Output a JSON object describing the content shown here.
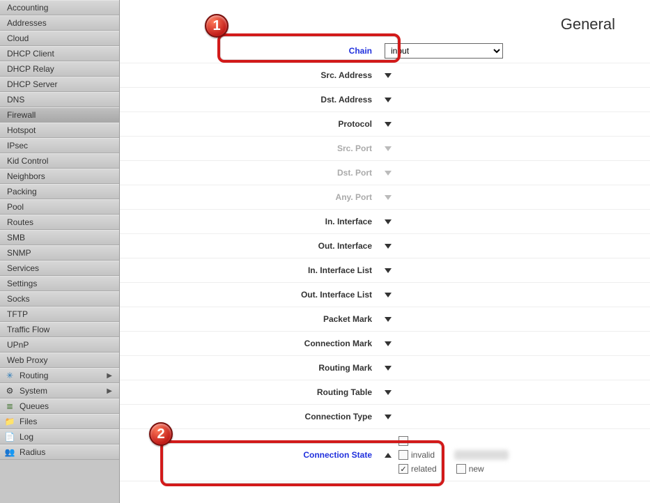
{
  "title": "General",
  "sidebar": {
    "items": [
      {
        "label": "Accounting"
      },
      {
        "label": "Addresses"
      },
      {
        "label": "Cloud"
      },
      {
        "label": "DHCP Client"
      },
      {
        "label": "DHCP Relay"
      },
      {
        "label": "DHCP Server"
      },
      {
        "label": "DNS"
      },
      {
        "label": "Firewall",
        "active": true
      },
      {
        "label": "Hotspot"
      },
      {
        "label": "IPsec"
      },
      {
        "label": "Kid Control"
      },
      {
        "label": "Neighbors"
      },
      {
        "label": "Packing"
      },
      {
        "label": "Pool"
      },
      {
        "label": "Routes"
      },
      {
        "label": "SMB"
      },
      {
        "label": "SNMP"
      },
      {
        "label": "Services"
      },
      {
        "label": "Settings"
      },
      {
        "label": "Socks"
      },
      {
        "label": "TFTP"
      },
      {
        "label": "Traffic Flow"
      },
      {
        "label": "UPnP"
      },
      {
        "label": "Web Proxy"
      }
    ],
    "iconItems": [
      {
        "label": "Routing",
        "icon": "routing",
        "expand": true
      },
      {
        "label": "System",
        "icon": "system",
        "expand": true
      },
      {
        "label": "Queues",
        "icon": "queues"
      },
      {
        "label": "Files",
        "icon": "files"
      },
      {
        "label": "Log",
        "icon": "log"
      },
      {
        "label": "Radius",
        "icon": "radius"
      }
    ]
  },
  "form": {
    "chain": {
      "label": "Chain",
      "value": "input"
    },
    "srcAddress": {
      "label": "Src. Address"
    },
    "dstAddress": {
      "label": "Dst. Address"
    },
    "protocol": {
      "label": "Protocol"
    },
    "srcPort": {
      "label": "Src. Port",
      "disabled": true
    },
    "dstPort": {
      "label": "Dst. Port",
      "disabled": true
    },
    "anyPort": {
      "label": "Any. Port",
      "disabled": true
    },
    "inInterface": {
      "label": "In. Interface"
    },
    "outInterface": {
      "label": "Out. Interface"
    },
    "inInterfaceList": {
      "label": "In. Interface List"
    },
    "outInterfaceList": {
      "label": "Out. Interface List"
    },
    "packetMark": {
      "label": "Packet Mark"
    },
    "connectionMark": {
      "label": "Connection Mark"
    },
    "routingMark": {
      "label": "Routing Mark"
    },
    "routingTable": {
      "label": "Routing Table"
    },
    "connectionType": {
      "label": "Connection Type"
    },
    "connectionState": {
      "label": "Connection State",
      "opts": {
        "invalid": {
          "label": "invalid",
          "checked": false
        },
        "related": {
          "label": "related",
          "checked": true
        },
        "new": {
          "label": "new",
          "checked": false
        }
      }
    }
  },
  "callouts": {
    "one": "1",
    "two": "2"
  }
}
